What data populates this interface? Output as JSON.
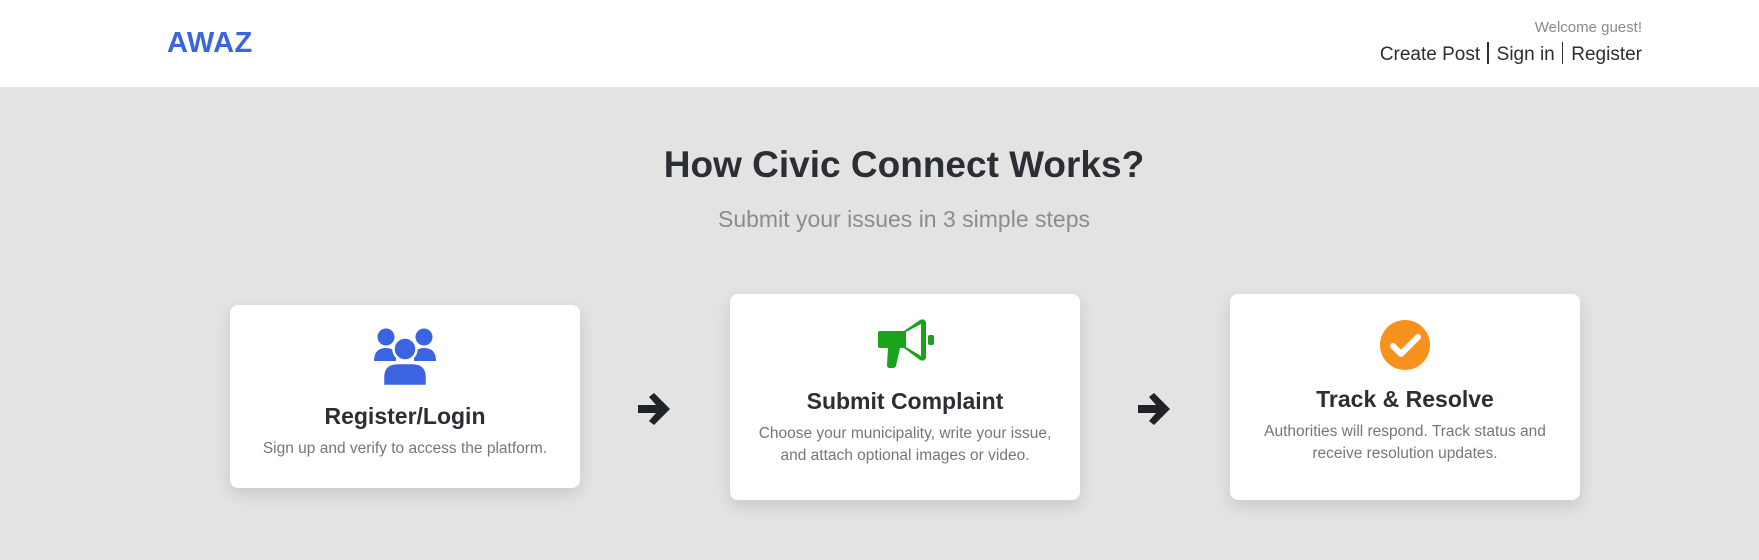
{
  "header": {
    "brand": "AWAZ",
    "welcome": "Welcome guest!",
    "links": {
      "create_post": "Create Post",
      "sign_in": "Sign in",
      "register": "Register"
    }
  },
  "hero": {
    "title": "How Civic Connect Works?",
    "subtitle": "Submit your issues in 3 simple steps"
  },
  "steps": [
    {
      "icon": "users-icon",
      "title": "Register/Login",
      "description": "Sign up and verify to access the platform.",
      "icon_color": "#3a64e0"
    },
    {
      "icon": "megaphone-icon",
      "title": "Submit Complaint",
      "description": "Choose your municipality, write your issue, and attach optional images or video.",
      "icon_color": "#1aa31a"
    },
    {
      "icon": "check-circle-icon",
      "title": "Track & Resolve",
      "description": "Authorities will respond. Track status and receive resolution updates.",
      "icon_color": "#f7921e"
    }
  ],
  "arrows": [
    "arrow-right-icon",
    "arrow-right-icon"
  ],
  "colors": {
    "brand": "#3a64e0",
    "background": "#e3e3e3",
    "text": "#2b2f33"
  }
}
